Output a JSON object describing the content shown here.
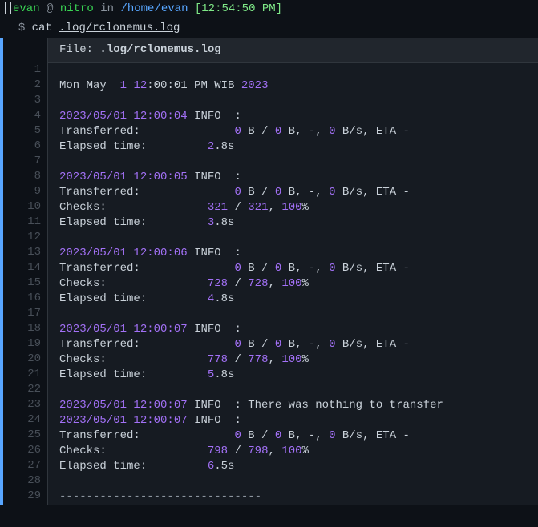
{
  "prompt": {
    "user": "evan",
    "at": " @ ",
    "host": "nitro",
    "in": " in ",
    "path": "/home/evan",
    "time": " [12:54:50 PM]",
    "symbol": "$ ",
    "cmd": "cat ",
    "arg": ".log/rclonemus.log"
  },
  "file": {
    "label": "File: ",
    "path": ".log/rclonemus.log"
  },
  "gutter": [
    "1",
    "2",
    "3",
    "4",
    "5",
    "6",
    "7",
    "8",
    "9",
    "10",
    "11",
    "12",
    "13",
    "14",
    "15",
    "16",
    "17",
    "18",
    "19",
    "20",
    "21",
    "22",
    "23",
    "24",
    "25",
    "26",
    "27",
    "28",
    "29"
  ],
  "l2": {
    "a": "Mon May  ",
    "b": "1",
    "c": " ",
    "d": "12",
    "e": ":00:01 PM WIB ",
    "f": "2023"
  },
  "l4": {
    "ts": "2023/05/01 12:00:04",
    "rest": " INFO  : "
  },
  "l5": {
    "a": "Transferred:   \t          ",
    "b": "0",
    "c": " B / ",
    "d": "0",
    "e": " B, -, ",
    "f": "0",
    "g": " B/s, ETA -"
  },
  "l6": {
    "a": "Elapsed time:         ",
    "b": "2",
    "c": ".8s"
  },
  "l8": {
    "ts": "2023/05/01 12:00:05",
    "rest": " INFO  : "
  },
  "l9": {
    "a": "Transferred:   \t          ",
    "b": "0",
    "c": " B / ",
    "d": "0",
    "e": " B, -, ",
    "f": "0",
    "g": " B/s, ETA -"
  },
  "l10": {
    "a": "Checks:               ",
    "b": "321",
    "c": " / ",
    "d": "321",
    "e": ", ",
    "f": "100",
    "g": "%"
  },
  "l11": {
    "a": "Elapsed time:         ",
    "b": "3",
    "c": ".8s"
  },
  "l13": {
    "ts": "2023/05/01 12:00:06",
    "rest": " INFO  : "
  },
  "l14": {
    "a": "Transferred:   \t          ",
    "b": "0",
    "c": " B / ",
    "d": "0",
    "e": " B, -, ",
    "f": "0",
    "g": " B/s, ETA -"
  },
  "l15": {
    "a": "Checks:               ",
    "b": "728",
    "c": " / ",
    "d": "728",
    "e": ", ",
    "f": "100",
    "g": "%"
  },
  "l16": {
    "a": "Elapsed time:         ",
    "b": "4",
    "c": ".8s"
  },
  "l18": {
    "ts": "2023/05/01 12:00:07",
    "rest": " INFO  : "
  },
  "l19": {
    "a": "Transferred:   \t          ",
    "b": "0",
    "c": " B / ",
    "d": "0",
    "e": " B, -, ",
    "f": "0",
    "g": " B/s, ETA -"
  },
  "l20": {
    "a": "Checks:               ",
    "b": "778",
    "c": " / ",
    "d": "778",
    "e": ", ",
    "f": "100",
    "g": "%"
  },
  "l21": {
    "a": "Elapsed time:         ",
    "b": "5",
    "c": ".8s"
  },
  "l23": {
    "ts": "2023/05/01 12:00:07",
    "rest": " INFO  : There was nothing to transfer"
  },
  "l24": {
    "ts": "2023/05/01 12:00:07",
    "rest": " INFO  : "
  },
  "l25": {
    "a": "Transferred:   \t          ",
    "b": "0",
    "c": " B / ",
    "d": "0",
    "e": " B, -, ",
    "f": "0",
    "g": " B/s, ETA -"
  },
  "l26": {
    "a": "Checks:               ",
    "b": "798",
    "c": " / ",
    "d": "798",
    "e": ", ",
    "f": "100",
    "g": "%"
  },
  "l27": {
    "a": "Elapsed time:         ",
    "b": "6",
    "c": ".5s"
  },
  "l29": "------------------------------"
}
